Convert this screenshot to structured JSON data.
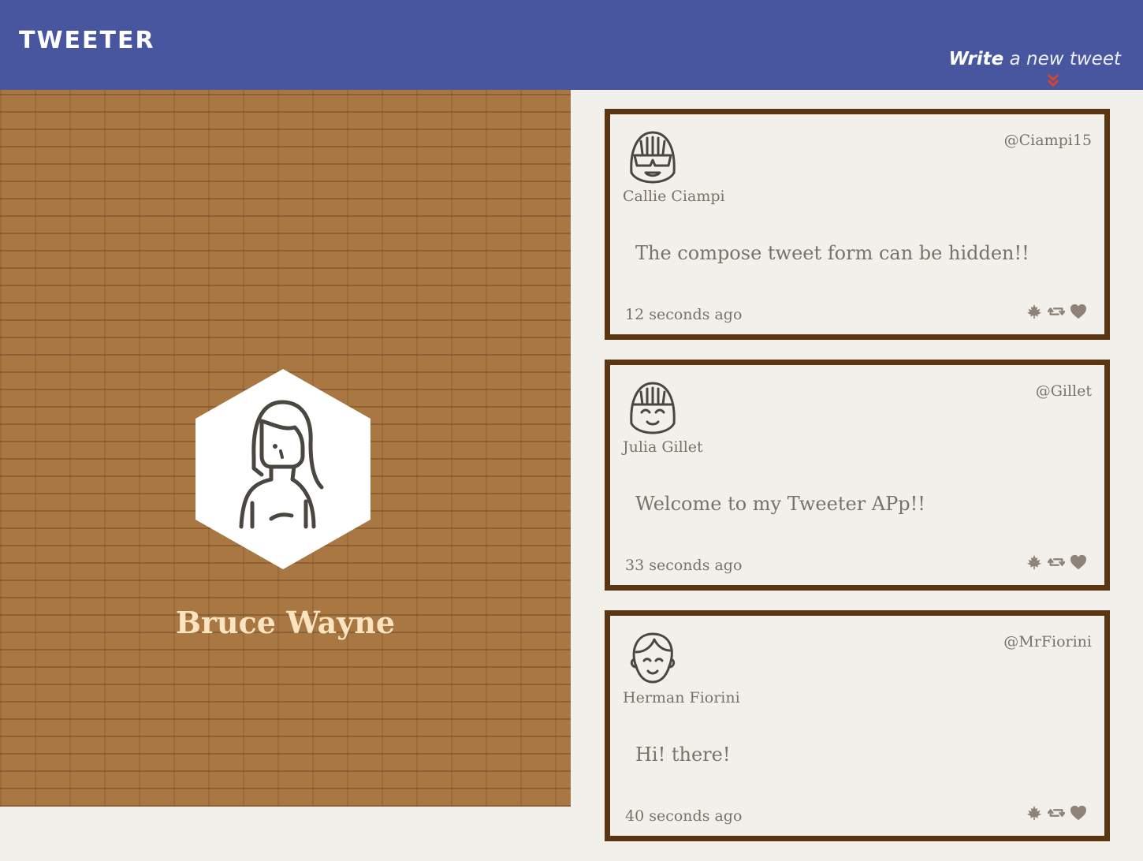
{
  "nav": {
    "brand": "TWEETER",
    "compose": {
      "strong": "Write",
      "rest": " a new tweet"
    }
  },
  "profile": {
    "name": "Bruce Wayne"
  },
  "tweets": [
    {
      "name": "Callie Ciampi",
      "handle": "@Ciampi15",
      "text": "The compose tweet form can be hidden!!",
      "time": "12 seconds ago"
    },
    {
      "name": "Julia Gillet",
      "handle": "@Gillet",
      "text": "Welcome to my Tweeter APp!!",
      "time": "33 seconds ago"
    },
    {
      "name": "Herman Fiorini",
      "handle": "@MrFiorini",
      "text": "Hi! there!",
      "time": "40 seconds ago"
    }
  ],
  "icons": {
    "flag": "maple-leaf-icon",
    "retweet": "retweet-icon",
    "like": "heart-icon"
  },
  "colors": {
    "nav": "#4856a0",
    "accent": "#d9452b",
    "card_border": "#5a3512",
    "profile_name": "#fbe4bf"
  }
}
